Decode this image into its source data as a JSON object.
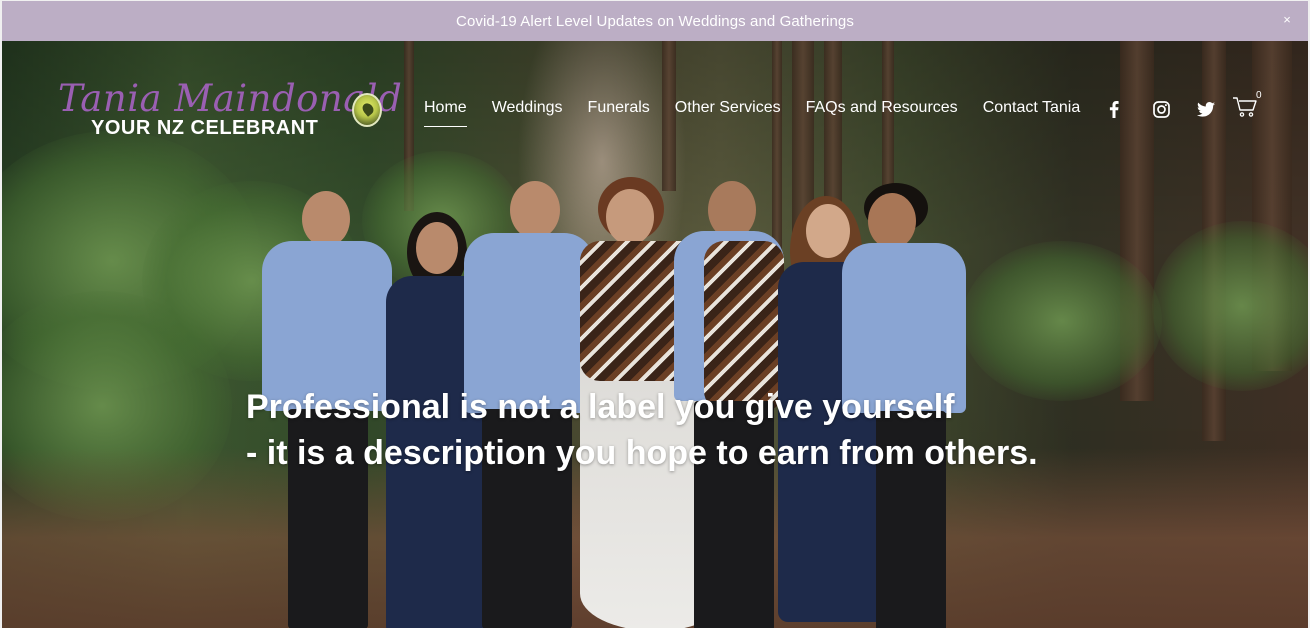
{
  "announcement": {
    "text": "Covid-19 Alert Level Updates on Weddings and Gatherings",
    "close_label": "×"
  },
  "logo": {
    "script_text": "Tania Maindonald",
    "subtitle": "YOUR NZ CELEBRANT",
    "script_color": "#9a5fb2"
  },
  "nav": {
    "items": [
      {
        "label": "Home",
        "active": true
      },
      {
        "label": "Weddings"
      },
      {
        "label": "Funerals"
      },
      {
        "label": "Other Services"
      },
      {
        "label": "FAQs and Resources"
      },
      {
        "label": "Contact Tania"
      }
    ]
  },
  "social": {
    "icons": [
      "facebook-icon",
      "instagram-icon",
      "twitter-icon"
    ]
  },
  "cart": {
    "count": "0",
    "icon": "cart-icon"
  },
  "hero": {
    "quote_line1": "Professional is not a label you give yourself",
    "quote_line2": "- it is a description you hope to earn from others."
  },
  "colors": {
    "announcement_bg": "#bcaec5",
    "text_light": "#ffffff"
  }
}
